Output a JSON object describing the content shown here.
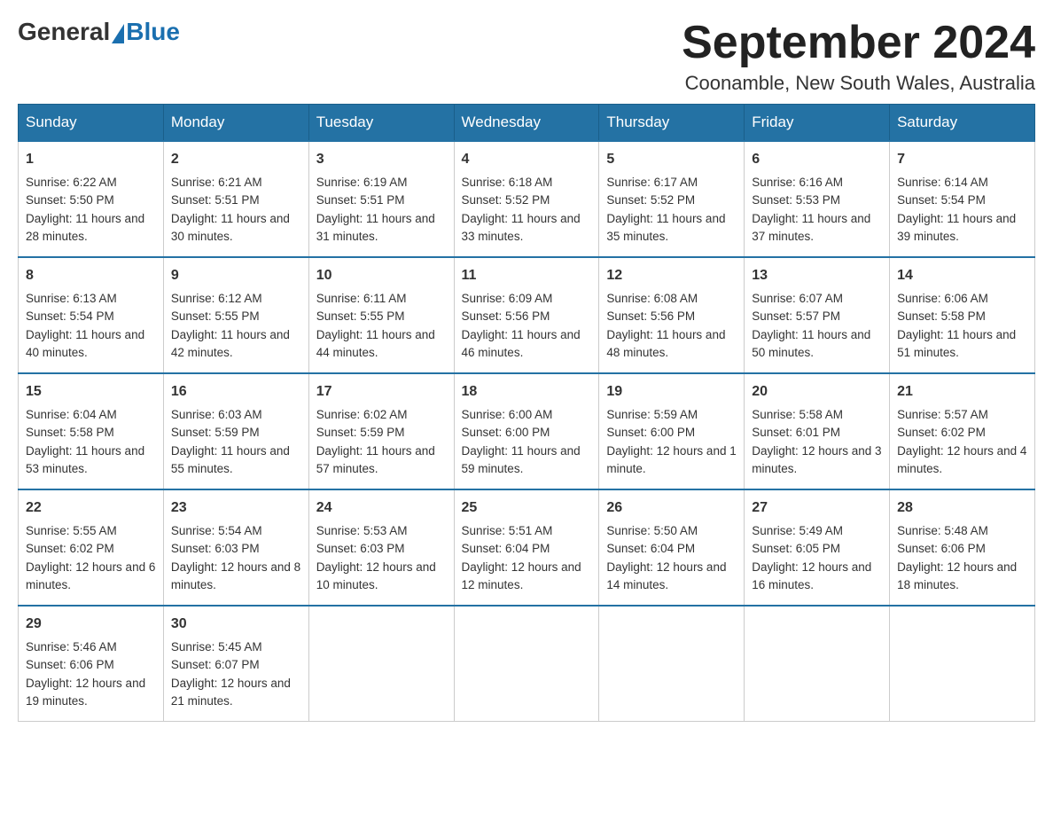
{
  "header": {
    "logo": {
      "general": "General",
      "blue": "Blue"
    },
    "title": "September 2024",
    "location": "Coonamble, New South Wales, Australia"
  },
  "calendar": {
    "weekdays": [
      "Sunday",
      "Monday",
      "Tuesday",
      "Wednesday",
      "Thursday",
      "Friday",
      "Saturday"
    ],
    "weeks": [
      [
        {
          "day": "1",
          "sunrise": "6:22 AM",
          "sunset": "5:50 PM",
          "daylight": "11 hours and 28 minutes."
        },
        {
          "day": "2",
          "sunrise": "6:21 AM",
          "sunset": "5:51 PM",
          "daylight": "11 hours and 30 minutes."
        },
        {
          "day": "3",
          "sunrise": "6:19 AM",
          "sunset": "5:51 PM",
          "daylight": "11 hours and 31 minutes."
        },
        {
          "day": "4",
          "sunrise": "6:18 AM",
          "sunset": "5:52 PM",
          "daylight": "11 hours and 33 minutes."
        },
        {
          "day": "5",
          "sunrise": "6:17 AM",
          "sunset": "5:52 PM",
          "daylight": "11 hours and 35 minutes."
        },
        {
          "day": "6",
          "sunrise": "6:16 AM",
          "sunset": "5:53 PM",
          "daylight": "11 hours and 37 minutes."
        },
        {
          "day": "7",
          "sunrise": "6:14 AM",
          "sunset": "5:54 PM",
          "daylight": "11 hours and 39 minutes."
        }
      ],
      [
        {
          "day": "8",
          "sunrise": "6:13 AM",
          "sunset": "5:54 PM",
          "daylight": "11 hours and 40 minutes."
        },
        {
          "day": "9",
          "sunrise": "6:12 AM",
          "sunset": "5:55 PM",
          "daylight": "11 hours and 42 minutes."
        },
        {
          "day": "10",
          "sunrise": "6:11 AM",
          "sunset": "5:55 PM",
          "daylight": "11 hours and 44 minutes."
        },
        {
          "day": "11",
          "sunrise": "6:09 AM",
          "sunset": "5:56 PM",
          "daylight": "11 hours and 46 minutes."
        },
        {
          "day": "12",
          "sunrise": "6:08 AM",
          "sunset": "5:56 PM",
          "daylight": "11 hours and 48 minutes."
        },
        {
          "day": "13",
          "sunrise": "6:07 AM",
          "sunset": "5:57 PM",
          "daylight": "11 hours and 50 minutes."
        },
        {
          "day": "14",
          "sunrise": "6:06 AM",
          "sunset": "5:58 PM",
          "daylight": "11 hours and 51 minutes."
        }
      ],
      [
        {
          "day": "15",
          "sunrise": "6:04 AM",
          "sunset": "5:58 PM",
          "daylight": "11 hours and 53 minutes."
        },
        {
          "day": "16",
          "sunrise": "6:03 AM",
          "sunset": "5:59 PM",
          "daylight": "11 hours and 55 minutes."
        },
        {
          "day": "17",
          "sunrise": "6:02 AM",
          "sunset": "5:59 PM",
          "daylight": "11 hours and 57 minutes."
        },
        {
          "day": "18",
          "sunrise": "6:00 AM",
          "sunset": "6:00 PM",
          "daylight": "11 hours and 59 minutes."
        },
        {
          "day": "19",
          "sunrise": "5:59 AM",
          "sunset": "6:00 PM",
          "daylight": "12 hours and 1 minute."
        },
        {
          "day": "20",
          "sunrise": "5:58 AM",
          "sunset": "6:01 PM",
          "daylight": "12 hours and 3 minutes."
        },
        {
          "day": "21",
          "sunrise": "5:57 AM",
          "sunset": "6:02 PM",
          "daylight": "12 hours and 4 minutes."
        }
      ],
      [
        {
          "day": "22",
          "sunrise": "5:55 AM",
          "sunset": "6:02 PM",
          "daylight": "12 hours and 6 minutes."
        },
        {
          "day": "23",
          "sunrise": "5:54 AM",
          "sunset": "6:03 PM",
          "daylight": "12 hours and 8 minutes."
        },
        {
          "day": "24",
          "sunrise": "5:53 AM",
          "sunset": "6:03 PM",
          "daylight": "12 hours and 10 minutes."
        },
        {
          "day": "25",
          "sunrise": "5:51 AM",
          "sunset": "6:04 PM",
          "daylight": "12 hours and 12 minutes."
        },
        {
          "day": "26",
          "sunrise": "5:50 AM",
          "sunset": "6:04 PM",
          "daylight": "12 hours and 14 minutes."
        },
        {
          "day": "27",
          "sunrise": "5:49 AM",
          "sunset": "6:05 PM",
          "daylight": "12 hours and 16 minutes."
        },
        {
          "day": "28",
          "sunrise": "5:48 AM",
          "sunset": "6:06 PM",
          "daylight": "12 hours and 18 minutes."
        }
      ],
      [
        {
          "day": "29",
          "sunrise": "5:46 AM",
          "sunset": "6:06 PM",
          "daylight": "12 hours and 19 minutes."
        },
        {
          "day": "30",
          "sunrise": "5:45 AM",
          "sunset": "6:07 PM",
          "daylight": "12 hours and 21 minutes."
        },
        null,
        null,
        null,
        null,
        null
      ]
    ],
    "labels": {
      "sunrise": "Sunrise: ",
      "sunset": "Sunset: ",
      "daylight": "Daylight: "
    }
  }
}
